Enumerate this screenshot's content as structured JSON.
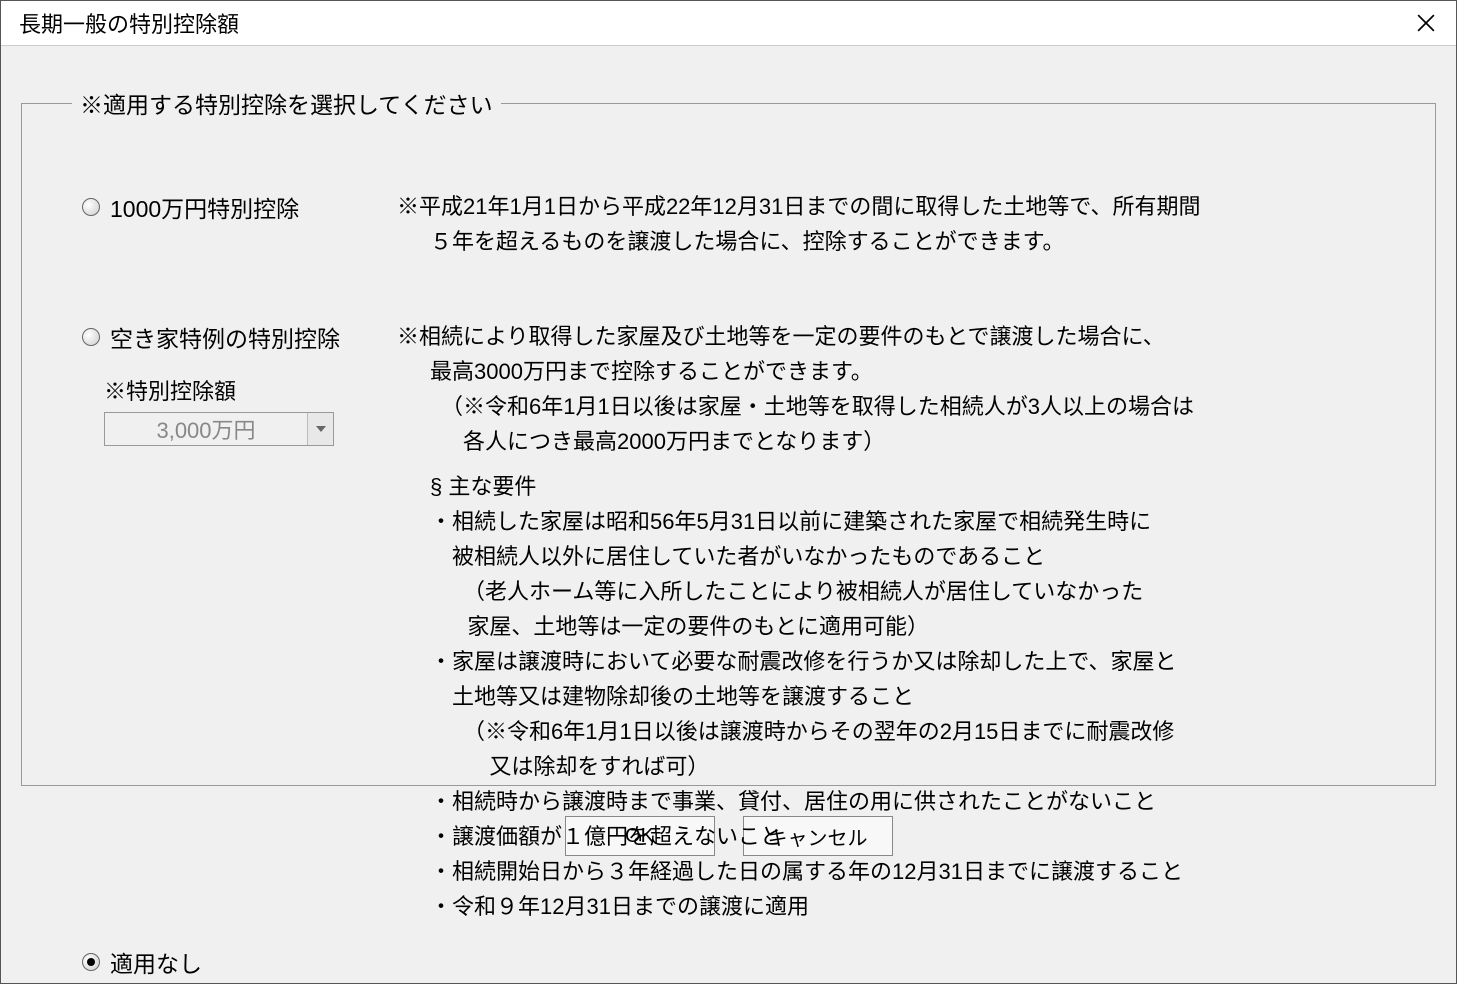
{
  "window": {
    "title": "長期一般の特別控除額"
  },
  "group": {
    "legend": "※適用する特別控除を選択してください"
  },
  "options": {
    "opt1": {
      "label": "1000万円特別控除",
      "desc_l1": "※平成21年1月1日から平成22年12月31日までの間に取得した土地等で、所有期間",
      "desc_l2": "５年を超えるものを譲渡した場合に、控除することができます。"
    },
    "opt2": {
      "label": "空き家特例の特別控除",
      "sub_label": "※特別控除額",
      "dropdown_value": "3,000万円",
      "desc_l1": "※相続により取得した家屋及び土地等を一定の要件のもとで譲渡した場合に、",
      "desc_l2": "最高3000万円まで控除することができます。",
      "desc_l3": "（※令和6年1月1日以後は家屋・土地等を取得した相続人が3人以上の場合は",
      "desc_l4": "各人につき最高2000万円までとなります）",
      "req_header": "§ 主な要件",
      "req1_a": "・相続した家屋は昭和56年5月31日以前に建築された家屋で相続発生時に",
      "req1_b": "被相続人以外に居住していた者がいなかったものであること",
      "req1_c": "（老人ホーム等に入所したことにより被相続人が居住していなかった",
      "req1_d": "家屋、土地等は一定の要件のもとに適用可能）",
      "req2_a": "・家屋は譲渡時において必要な耐震改修を行うか又は除却した上で、家屋と",
      "req2_b": "土地等又は建物除却後の土地等を譲渡すること",
      "req2_c": "（※令和6年1月1日以後は譲渡時からその翌年の2月15日までに耐震改修",
      "req2_d": "又は除却をすれば可）",
      "req3": "・相続時から譲渡時まで事業、貸付、居住の用に供されたことがないこと",
      "req4": "・譲渡価額が１億円を超えないこと",
      "req5": "・相続開始日から３年経過した日の属する年の12月31日までに譲渡すること",
      "req6": "・令和９年12月31日までの譲渡に適用"
    },
    "opt3": {
      "label": "適用なし"
    }
  },
  "buttons": {
    "ok": "OK",
    "cancel": "キャンセル"
  }
}
